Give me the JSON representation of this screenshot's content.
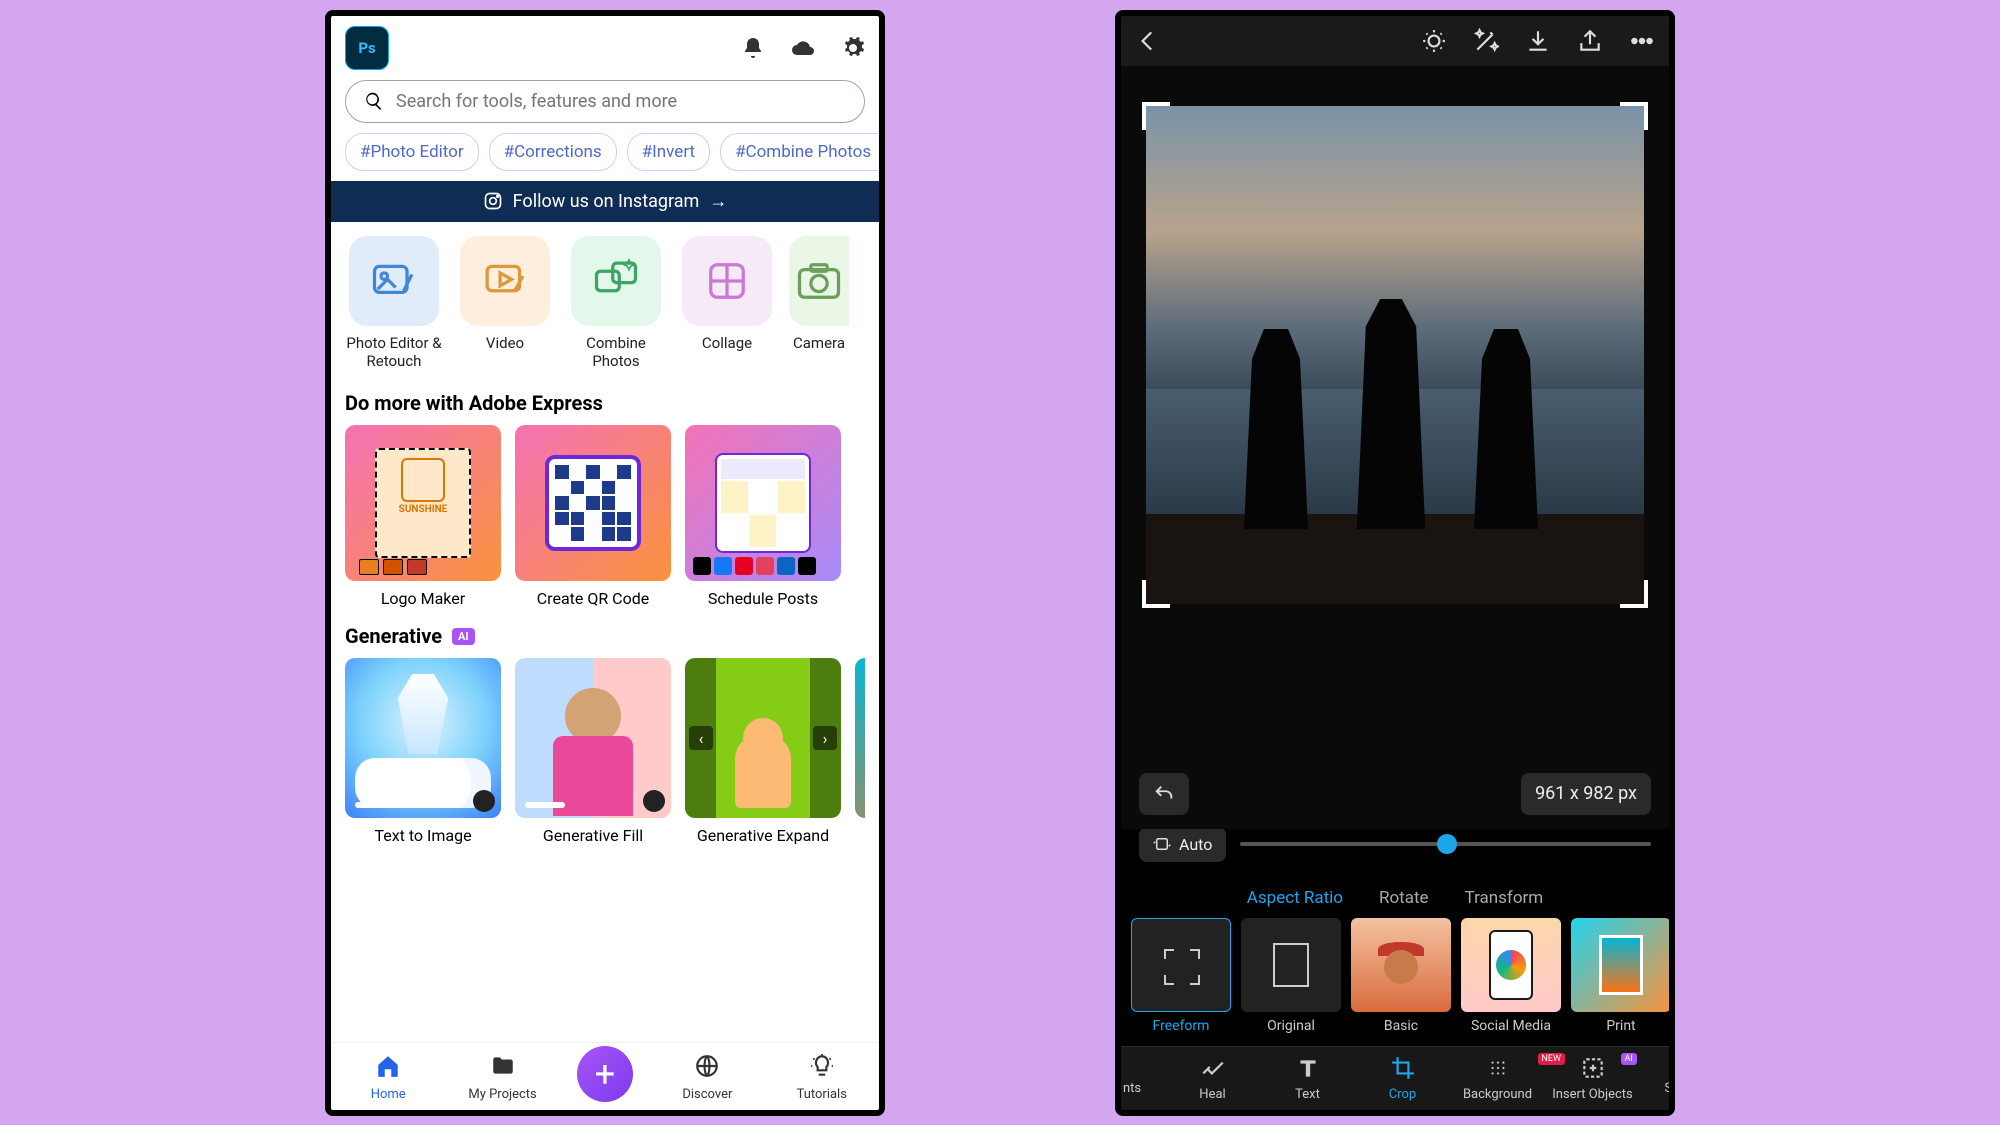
{
  "phone1": {
    "header": {
      "ps_label": "Ps"
    },
    "search": {
      "placeholder": "Search for tools, features and more"
    },
    "chips": [
      "#Photo Editor",
      "#Corrections",
      "#Invert",
      "#Combine Photos"
    ],
    "instagram": "Follow us on Instagram",
    "tools": [
      {
        "label": "Photo Editor & Retouch"
      },
      {
        "label": "Video"
      },
      {
        "label": "Combine Photos"
      },
      {
        "label": "Collage"
      },
      {
        "label": "Camera"
      }
    ],
    "express_title": "Do more with Adobe Express",
    "express": [
      {
        "label": "Logo Maker",
        "sub": "SUNSHINE"
      },
      {
        "label": "Create QR Code"
      },
      {
        "label": "Schedule Posts"
      }
    ],
    "generative_title": "Generative",
    "ai_badge": "AI",
    "gen": [
      {
        "label": "Text to Image"
      },
      {
        "label": "Generative Fill"
      },
      {
        "label": "Generative Expand"
      }
    ],
    "nav": {
      "home": "Home",
      "projects": "My Projects",
      "discover": "Discover",
      "tutorials": "Tutorials"
    }
  },
  "phone2": {
    "dimensions": "961 x 982 px",
    "auto": "Auto",
    "tabs": {
      "aspect": "Aspect Ratio",
      "rotate": "Rotate",
      "transform": "Transform"
    },
    "ratios": [
      {
        "label": "Freeform"
      },
      {
        "label": "Original"
      },
      {
        "label": "Basic"
      },
      {
        "label": "Social Media"
      },
      {
        "label": "Print"
      }
    ],
    "tools": {
      "nts": "nts",
      "heal": "Heal",
      "text": "Text",
      "crop": "Crop",
      "bg": "Background",
      "insert": "Insert Objects",
      "sw": "Sw",
      "new": "NEW",
      "ai": "AI"
    }
  }
}
